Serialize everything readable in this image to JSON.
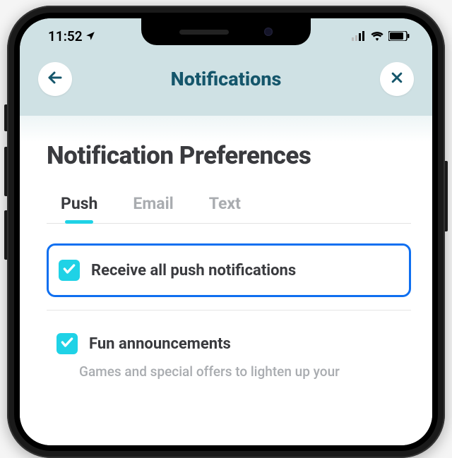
{
  "status": {
    "time": "11:52"
  },
  "header": {
    "title": "Notifications"
  },
  "page": {
    "title": "Notification Preferences"
  },
  "tabs": [
    {
      "label": "Push",
      "active": true
    },
    {
      "label": "Email",
      "active": false
    },
    {
      "label": "Text",
      "active": false
    }
  ],
  "options": {
    "all": {
      "label": "Receive all push notifications",
      "checked": true
    },
    "fun": {
      "label": "Fun announcements",
      "checked": true,
      "desc": "Games and special offers to lighten up your"
    }
  }
}
